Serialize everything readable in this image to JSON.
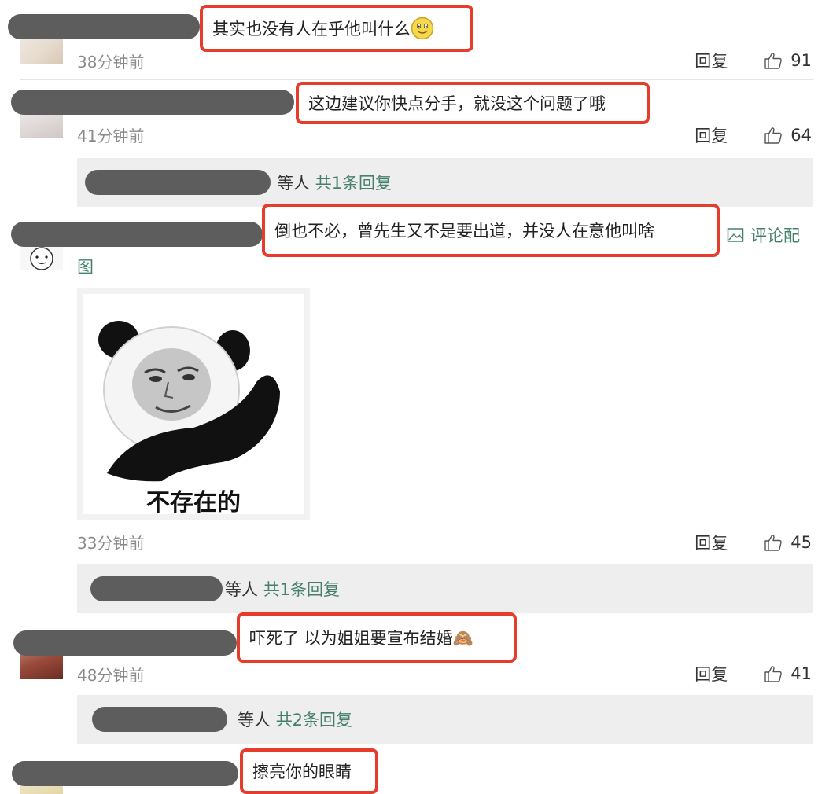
{
  "comments": [
    {
      "text": "其实也没有人在乎他叫什么",
      "emoji": "smiley-face",
      "time": "38分钟前",
      "reply_label": "回复",
      "likes": "91"
    },
    {
      "text": "这边建议你快点分手，就没这个问题了哦",
      "time": "41分钟前",
      "reply_label": "回复",
      "likes": "64",
      "replies": {
        "suffix": "等人",
        "link": "共1条回复"
      }
    },
    {
      "text": "倒也不必，曾先生又不是要出道，并没人在意他叫啥",
      "attachment_icon": "image-icon",
      "attachment_label_1": "评论配",
      "attachment_label_2": "图",
      "meme_caption": "不存在的",
      "time": "33分钟前",
      "reply_label": "回复",
      "likes": "45",
      "replies": {
        "suffix": "等人",
        "link": "共1条回复"
      }
    },
    {
      "text": "吓死了 以为姐姐要宣布结婚🙈",
      "time": "48分钟前",
      "reply_label": "回复",
      "likes": "41",
      "replies": {
        "suffix": "等人",
        "link": "共2条回复"
      }
    },
    {
      "text": "擦亮你的眼睛"
    }
  ],
  "colors": {
    "highlight_border": "#e63c2c",
    "link_green": "#46806c",
    "redaction": "#5d5d5d",
    "reply_panel_bg": "#eeeeee"
  }
}
